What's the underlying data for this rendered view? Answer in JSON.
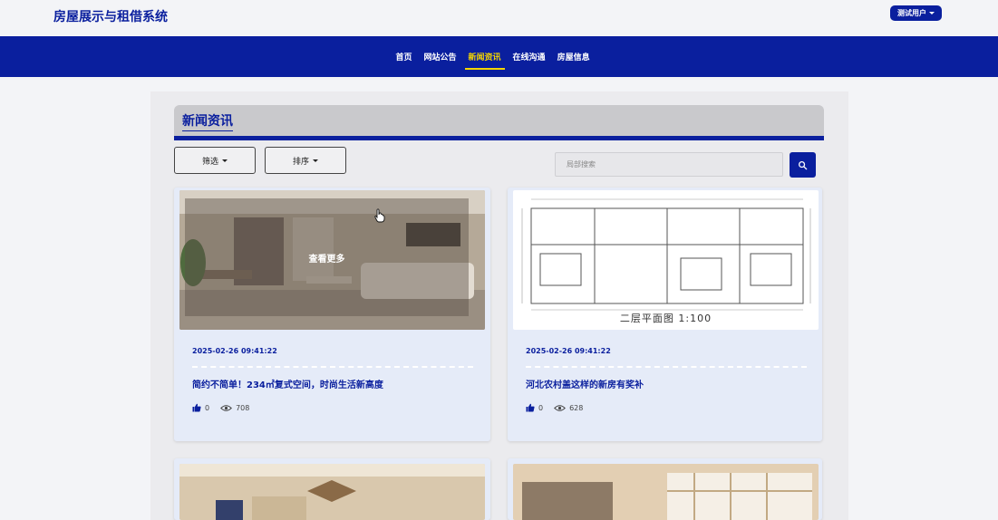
{
  "header": {
    "title": "房屋展示与租借系统",
    "user_label": "测试用户"
  },
  "nav": {
    "items": [
      "首页",
      "网站公告",
      "新闻资讯",
      "在线沟通",
      "房屋信息"
    ],
    "active_index": 2
  },
  "section": {
    "title": "新闻资讯"
  },
  "filters": {
    "filter_label": "筛选",
    "sort_label": "排序"
  },
  "search": {
    "placeholder": "局部搜索"
  },
  "cards": [
    {
      "date": "2025-02-26 09:41:22",
      "title": "简约不简单！234㎡复式空间，时尚生活新高度",
      "likes": "0",
      "views": "708",
      "overlay_text": "查看更多"
    },
    {
      "date": "2025-02-26 09:41:22",
      "title": "河北农村盖这样的新房有奖补",
      "likes": "0",
      "views": "628",
      "plan_caption": "二层平面图 1:100"
    }
  ],
  "colors": {
    "brand": "#0a1f9e",
    "accent": "#f4d500"
  }
}
